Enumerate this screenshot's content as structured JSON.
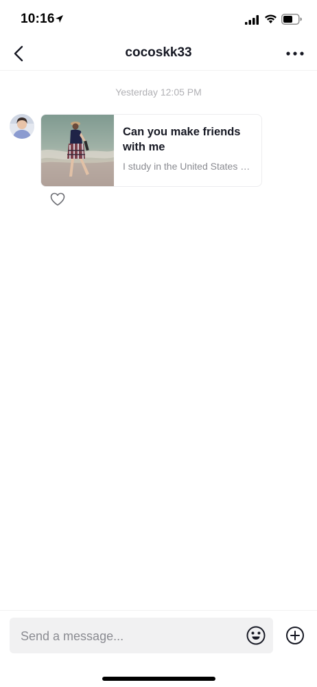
{
  "status_bar": {
    "time": "10:16"
  },
  "header": {
    "title": "cocoskk33"
  },
  "conversation": {
    "timestamp": "Yesterday 12:05 PM",
    "messages": [
      {
        "type": "shared-video",
        "title": "Can you make friends with me",
        "subtitle": "I study in the United States and live on the beach"
      }
    ]
  },
  "composer": {
    "placeholder": "Send a message..."
  },
  "icons": {
    "back": "chevron-left-icon",
    "more": "more-dots-icon",
    "like": "heart-outline-icon",
    "emoji": "emoji-icon",
    "add": "plus-circle-icon"
  },
  "colors": {
    "text_primary": "#161823",
    "text_secondary": "#8a8b91",
    "timestamp": "#b0b0b4",
    "input_background": "#f1f1f2"
  }
}
